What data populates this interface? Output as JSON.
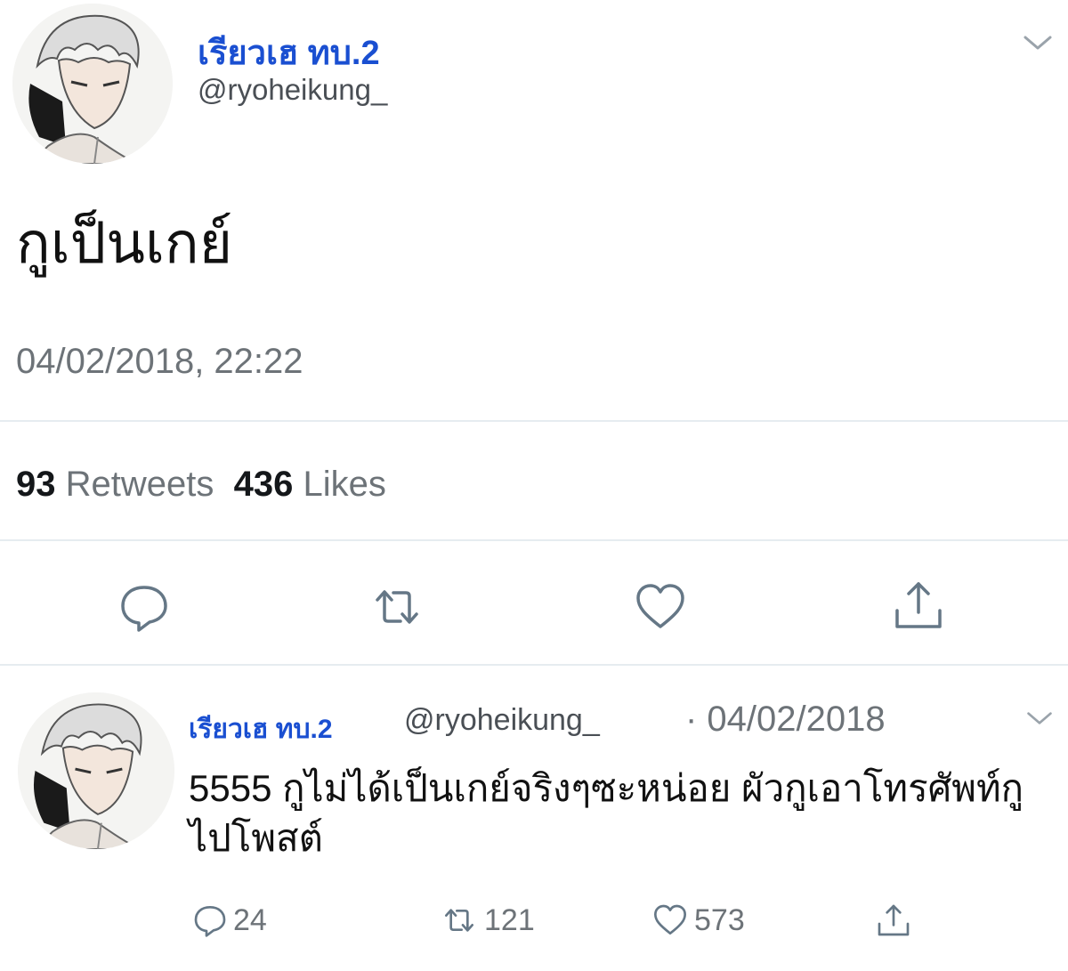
{
  "main_tweet": {
    "display_name": "เรียวเฮ ทบ.2",
    "handle": "@ryoheikung_",
    "text": "กูเป็นเกย์",
    "timestamp": "04/02/2018, 22:22",
    "retweet_count": "93",
    "retweet_label": "Retweets",
    "like_count": "436",
    "like_label": "Likes"
  },
  "reply_tweet": {
    "display_name": "เรียวเฮ ทบ.2",
    "handle": "@ryoheikung_",
    "date": "· 04/02/2018",
    "text": "5555 กูไม่ได้เป็นเกย์จริงๆซะหน่อย ผัวกูเอาโทรศัพท์กูไปโพสต์",
    "reply_count": "24",
    "retweet_count": "121",
    "like_count": "573"
  },
  "icons": [
    "chevron-down-icon",
    "reply-icon",
    "retweet-icon",
    "like-icon",
    "share-icon"
  ],
  "colors": {
    "name_blue": "#1a4fd1",
    "secondary_text": "#6d7378",
    "icon_gray": "#657786",
    "divider": "#e6ecf0"
  }
}
